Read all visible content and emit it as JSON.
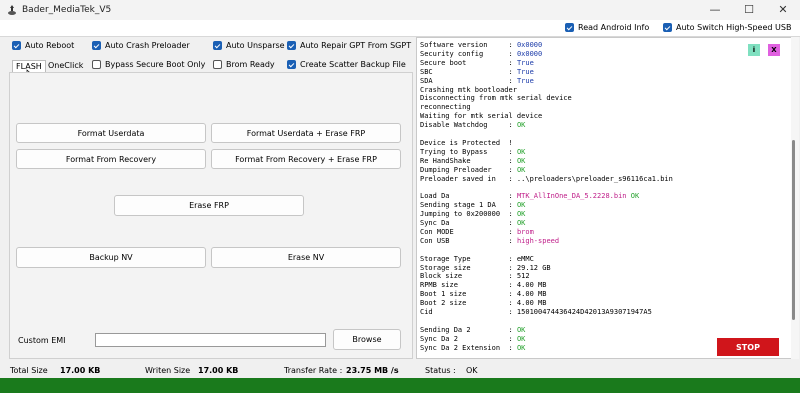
{
  "window": {
    "title": "Bader_MediaTek_V5",
    "minimize_icon": "minimize-icon",
    "maximize_icon": "maximize-icon",
    "close_icon": "close-icon"
  },
  "topbar": {
    "read_android_info": {
      "label": "Read Android Info",
      "checked": true
    },
    "auto_switch_usb": {
      "label": "Auto Switch High-Speed USB",
      "checked": true
    }
  },
  "options": [
    {
      "label": "Auto Reboot",
      "checked": true
    },
    {
      "label": "Auto Crash Preloader",
      "checked": true
    },
    {
      "label": "Auto Unsparse",
      "checked": true
    },
    {
      "label": "Auto Repair GPT From SGPT",
      "checked": true
    },
    {
      "label": "Bypass Secure Boot Only",
      "checked": false
    },
    {
      "label": "Brom Ready",
      "checked": false
    },
    {
      "label": "Create Scatter Backup File",
      "checked": true
    }
  ],
  "tabs": [
    "FLASH",
    "OneClick"
  ],
  "buttons": {
    "format_userdata": "Format Userdata",
    "format_userdata_frp": "Format Userdata + Erase FRP",
    "format_recovery": "Format From Recovery",
    "format_recovery_frp": "Format From Recovery + Erase FRP",
    "erase_frp": "Erase FRP",
    "backup_nv": "Backup NV",
    "erase_nv": "Erase NV",
    "browse": "Browse",
    "stop": "STOP"
  },
  "imei": {
    "label": "Custom EMI",
    "value": ""
  },
  "log": [
    {
      "text": "Software version     : ",
      "val": "0x0000",
      "color": "#1a3aa8"
    },
    {
      "text": "Security config      : ",
      "val": "0x0000",
      "color": "#1a3aa8"
    },
    {
      "text": "Secure boot          : ",
      "val": "True",
      "color": "#1a3aa8"
    },
    {
      "text": "SBC                  : ",
      "val": "True",
      "color": "#1a3aa8"
    },
    {
      "text": "SDA                  : ",
      "val": "True",
      "color": "#1a3aa8"
    },
    {
      "text": "Crashing mtk bootloader",
      "val": "",
      "color": "#000"
    },
    {
      "text": "Disconnecting from mtk serial device",
      "val": "",
      "color": "#000"
    },
    {
      "text": "reconnecting",
      "val": "",
      "color": "#000"
    },
    {
      "text": "Waiting for mtk serial device",
      "val": "",
      "color": "#000"
    },
    {
      "text": "Disable Watchdog     : ",
      "val": "OK",
      "color": "#23a12b"
    },
    {
      "text": "",
      "val": "",
      "color": "#000"
    },
    {
      "text": "Device is Protected  !",
      "val": "",
      "color": "#000"
    },
    {
      "text": "Trying to Bypass     : ",
      "val": "OK",
      "color": "#23a12b"
    },
    {
      "text": "Re HandShake         : ",
      "val": "OK",
      "color": "#23a12b"
    },
    {
      "text": "Dumping Preloader    : ",
      "val": "OK",
      "color": "#23a12b"
    },
    {
      "text": "Preloader saved in   : ..\\preloaders\\preloader_s96116ca1.bin",
      "val": "",
      "color": "#000"
    },
    {
      "text": "",
      "val": "",
      "color": "#000"
    },
    {
      "text": "Load Da              : ",
      "val": "MTK_AllInOne_DA_5.2228.bin",
      "color": "#c0208a",
      "extra": " OK",
      "extra_color": "#23a12b"
    },
    {
      "text": "Sending stage 1 DA   : ",
      "val": "OK",
      "color": "#23a12b"
    },
    {
      "text": "Jumping to 0x200000  : ",
      "val": "OK",
      "color": "#23a12b"
    },
    {
      "text": "Sync Da              : ",
      "val": "OK",
      "color": "#23a12b"
    },
    {
      "text": "Con MODE             : ",
      "val": "brom",
      "color": "#c0208a"
    },
    {
      "text": "Con USB              : ",
      "val": "high-speed",
      "color": "#c0208a"
    },
    {
      "text": "",
      "val": "",
      "color": "#000"
    },
    {
      "text": "Storage Type         : eMMC",
      "val": "",
      "color": "#000"
    },
    {
      "text": "Storage size         : 29.12 GB",
      "val": "",
      "color": "#000"
    },
    {
      "text": "Block size           : 512",
      "val": "",
      "color": "#000"
    },
    {
      "text": "RPMB size            : 4.00 MB",
      "val": "",
      "color": "#000"
    },
    {
      "text": "Boot 1 size          : 4.00 MB",
      "val": "",
      "color": "#000"
    },
    {
      "text": "Boot 2 size          : 4.00 MB",
      "val": "",
      "color": "#000"
    },
    {
      "text": "Cid                  : 150100474436424D42013A93071947A5",
      "val": "",
      "color": "#000"
    },
    {
      "text": "",
      "val": "",
      "color": "#000"
    },
    {
      "text": "Sending Da 2         : ",
      "val": "OK",
      "color": "#23a12b"
    },
    {
      "text": "Sync Da 2            : ",
      "val": "OK",
      "color": "#23a12b"
    },
    {
      "text": "Sync Da 2 Extension  : ",
      "val": "OK",
      "color": "#23a12b"
    }
  ],
  "mini_buttons": [
    {
      "label": "i",
      "color": "#7fe0c0"
    },
    {
      "label": "X",
      "color": "#e060e0"
    }
  ],
  "status": {
    "total_size_label": "Total Size",
    "total_size": "17.00 KB",
    "written_label": "Writen Size",
    "written": "17.00 KB",
    "rate_label": "Transfer Rate :",
    "rate": "23.75 MB /s",
    "status_label": "Status :",
    "status": "OK"
  },
  "colors": {
    "accent": "#1a5fb4",
    "stop": "#d0151b",
    "green_bar": "#1a7a1c"
  }
}
